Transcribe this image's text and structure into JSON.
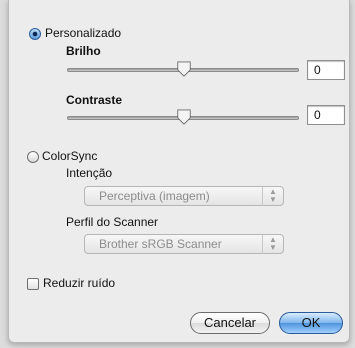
{
  "custom": {
    "label": "Personalizado",
    "selected": true
  },
  "brightness": {
    "label": "Brilho",
    "value": "0",
    "slider_level": 0.5
  },
  "contrast": {
    "label": "Contraste",
    "value": "0",
    "slider_level": 0.5
  },
  "colorsync": {
    "label": "ColorSync",
    "selected": false,
    "intent_label": "Intenção",
    "intent_value": "Perceptiva (imagem)",
    "profile_label": "Perfil do Scanner",
    "profile_value": "Brother sRGB Scanner"
  },
  "noise": {
    "label": "Reduzir ruído",
    "checked": false
  },
  "buttons": {
    "cancel": "Cancelar",
    "ok": "OK"
  }
}
